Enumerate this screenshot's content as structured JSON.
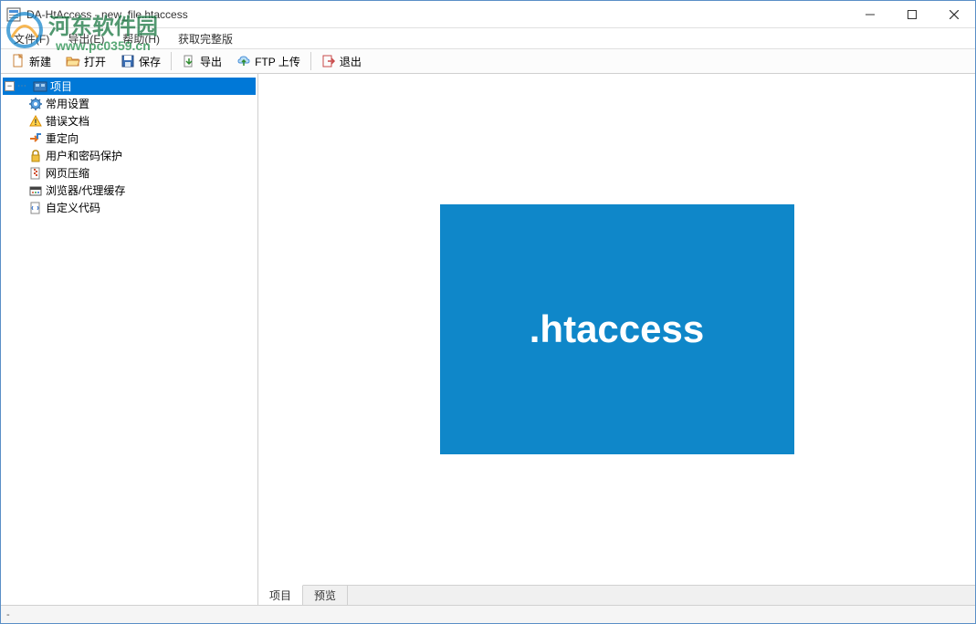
{
  "window": {
    "title": "DA-HtAccess - new_file.htaccess"
  },
  "menu": {
    "file": "文件(F)",
    "export": "导出(E)",
    "help": "帮助(H)",
    "getfull": "获取完整版"
  },
  "toolbar": {
    "new": "新建",
    "open": "打开",
    "save": "保存",
    "export": "导出",
    "ftp": "FTP 上传",
    "exit": "退出"
  },
  "tree": {
    "root": "项目",
    "items": [
      {
        "label": "常用设置",
        "icon": "settings"
      },
      {
        "label": "错误文档",
        "icon": "error"
      },
      {
        "label": "重定向",
        "icon": "redirect"
      },
      {
        "label": "用户和密码保护",
        "icon": "lock"
      },
      {
        "label": "网页压缩",
        "icon": "compress"
      },
      {
        "label": "浏览器/代理缓存",
        "icon": "cache"
      },
      {
        "label": "自定义代码",
        "icon": "code"
      }
    ]
  },
  "main": {
    "logo_text": ".htaccess"
  },
  "tabs": {
    "project": "项目",
    "preview": "预览"
  },
  "status": "-",
  "watermark": {
    "line1": "河东软件园",
    "line2": "www.pc0359.cn"
  }
}
